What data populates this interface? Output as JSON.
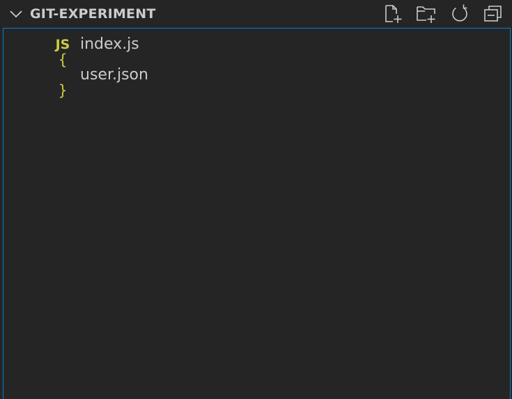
{
  "explorer": {
    "folder_title": "GIT-EXPERIMENT",
    "actions": [
      {
        "icon": "new-file-icon"
      },
      {
        "icon": "new-folder-icon"
      },
      {
        "icon": "refresh-icon"
      },
      {
        "icon": "collapse-all-icon"
      }
    ],
    "files": [
      {
        "icon_text": "JS",
        "icon": "javascript-file-icon",
        "name": "index.js"
      },
      {
        "icon_text": "{ }",
        "icon": "json-file-icon",
        "name": "user.json"
      }
    ]
  },
  "colors": {
    "background": "#252526",
    "text": "#cccccc",
    "focus_border": "#007fd4",
    "file_icon": "#cbcb41"
  }
}
